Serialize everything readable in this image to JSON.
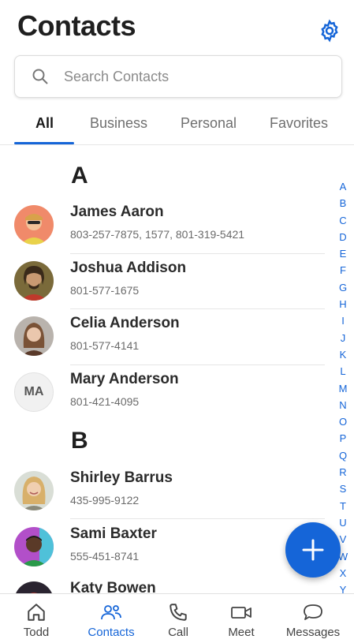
{
  "header": {
    "title": "Contacts",
    "settings_icon": "gear-icon"
  },
  "search": {
    "placeholder": "Search Contacts",
    "icon": "search-icon"
  },
  "tabs": [
    {
      "label": "All",
      "active": true
    },
    {
      "label": "Business",
      "active": false
    },
    {
      "label": "Personal",
      "active": false
    },
    {
      "label": "Favorites",
      "active": false
    }
  ],
  "sections": [
    {
      "letter": "A",
      "contacts": [
        {
          "name": "James Aaron",
          "phone": "803-257-7875, 1577, 801-319-5421",
          "avatar": "photo"
        },
        {
          "name": "Joshua Addison",
          "phone": "801-577-1675",
          "avatar": "photo"
        },
        {
          "name": "Celia Anderson",
          "phone": "801-577-4141",
          "avatar": "photo"
        },
        {
          "name": "Mary Anderson",
          "phone": "801-421-4095",
          "avatar": "initials",
          "initials": "MA"
        }
      ]
    },
    {
      "letter": "B",
      "contacts": [
        {
          "name": "Shirley Barrus",
          "phone": "435-995-9122",
          "avatar": "photo"
        },
        {
          "name": "Sami Baxter",
          "phone": "555-451-8741",
          "avatar": "photo"
        },
        {
          "name": "Katy Bowen",
          "phone": "",
          "avatar": "photo"
        }
      ]
    }
  ],
  "alphabet": [
    "A",
    "B",
    "C",
    "D",
    "E",
    "F",
    "G",
    "H",
    "I",
    "J",
    "K",
    "L",
    "M",
    "N",
    "O",
    "P",
    "Q",
    "R",
    "S",
    "T",
    "U",
    "V",
    "W",
    "X",
    "Y"
  ],
  "fab": {
    "icon": "plus-icon"
  },
  "bottom_nav": [
    {
      "label": "Todd",
      "icon": "home-icon",
      "active": false
    },
    {
      "label": "Contacts",
      "icon": "contacts-icon",
      "active": true
    },
    {
      "label": "Call",
      "icon": "phone-icon",
      "active": false
    },
    {
      "label": "Meet",
      "icon": "video-icon",
      "active": false
    },
    {
      "label": "Messages",
      "icon": "chat-icon",
      "active": false
    }
  ],
  "colors": {
    "accent": "#1565d8",
    "text": "#1f1f1f",
    "muted": "#6a6a6a"
  }
}
